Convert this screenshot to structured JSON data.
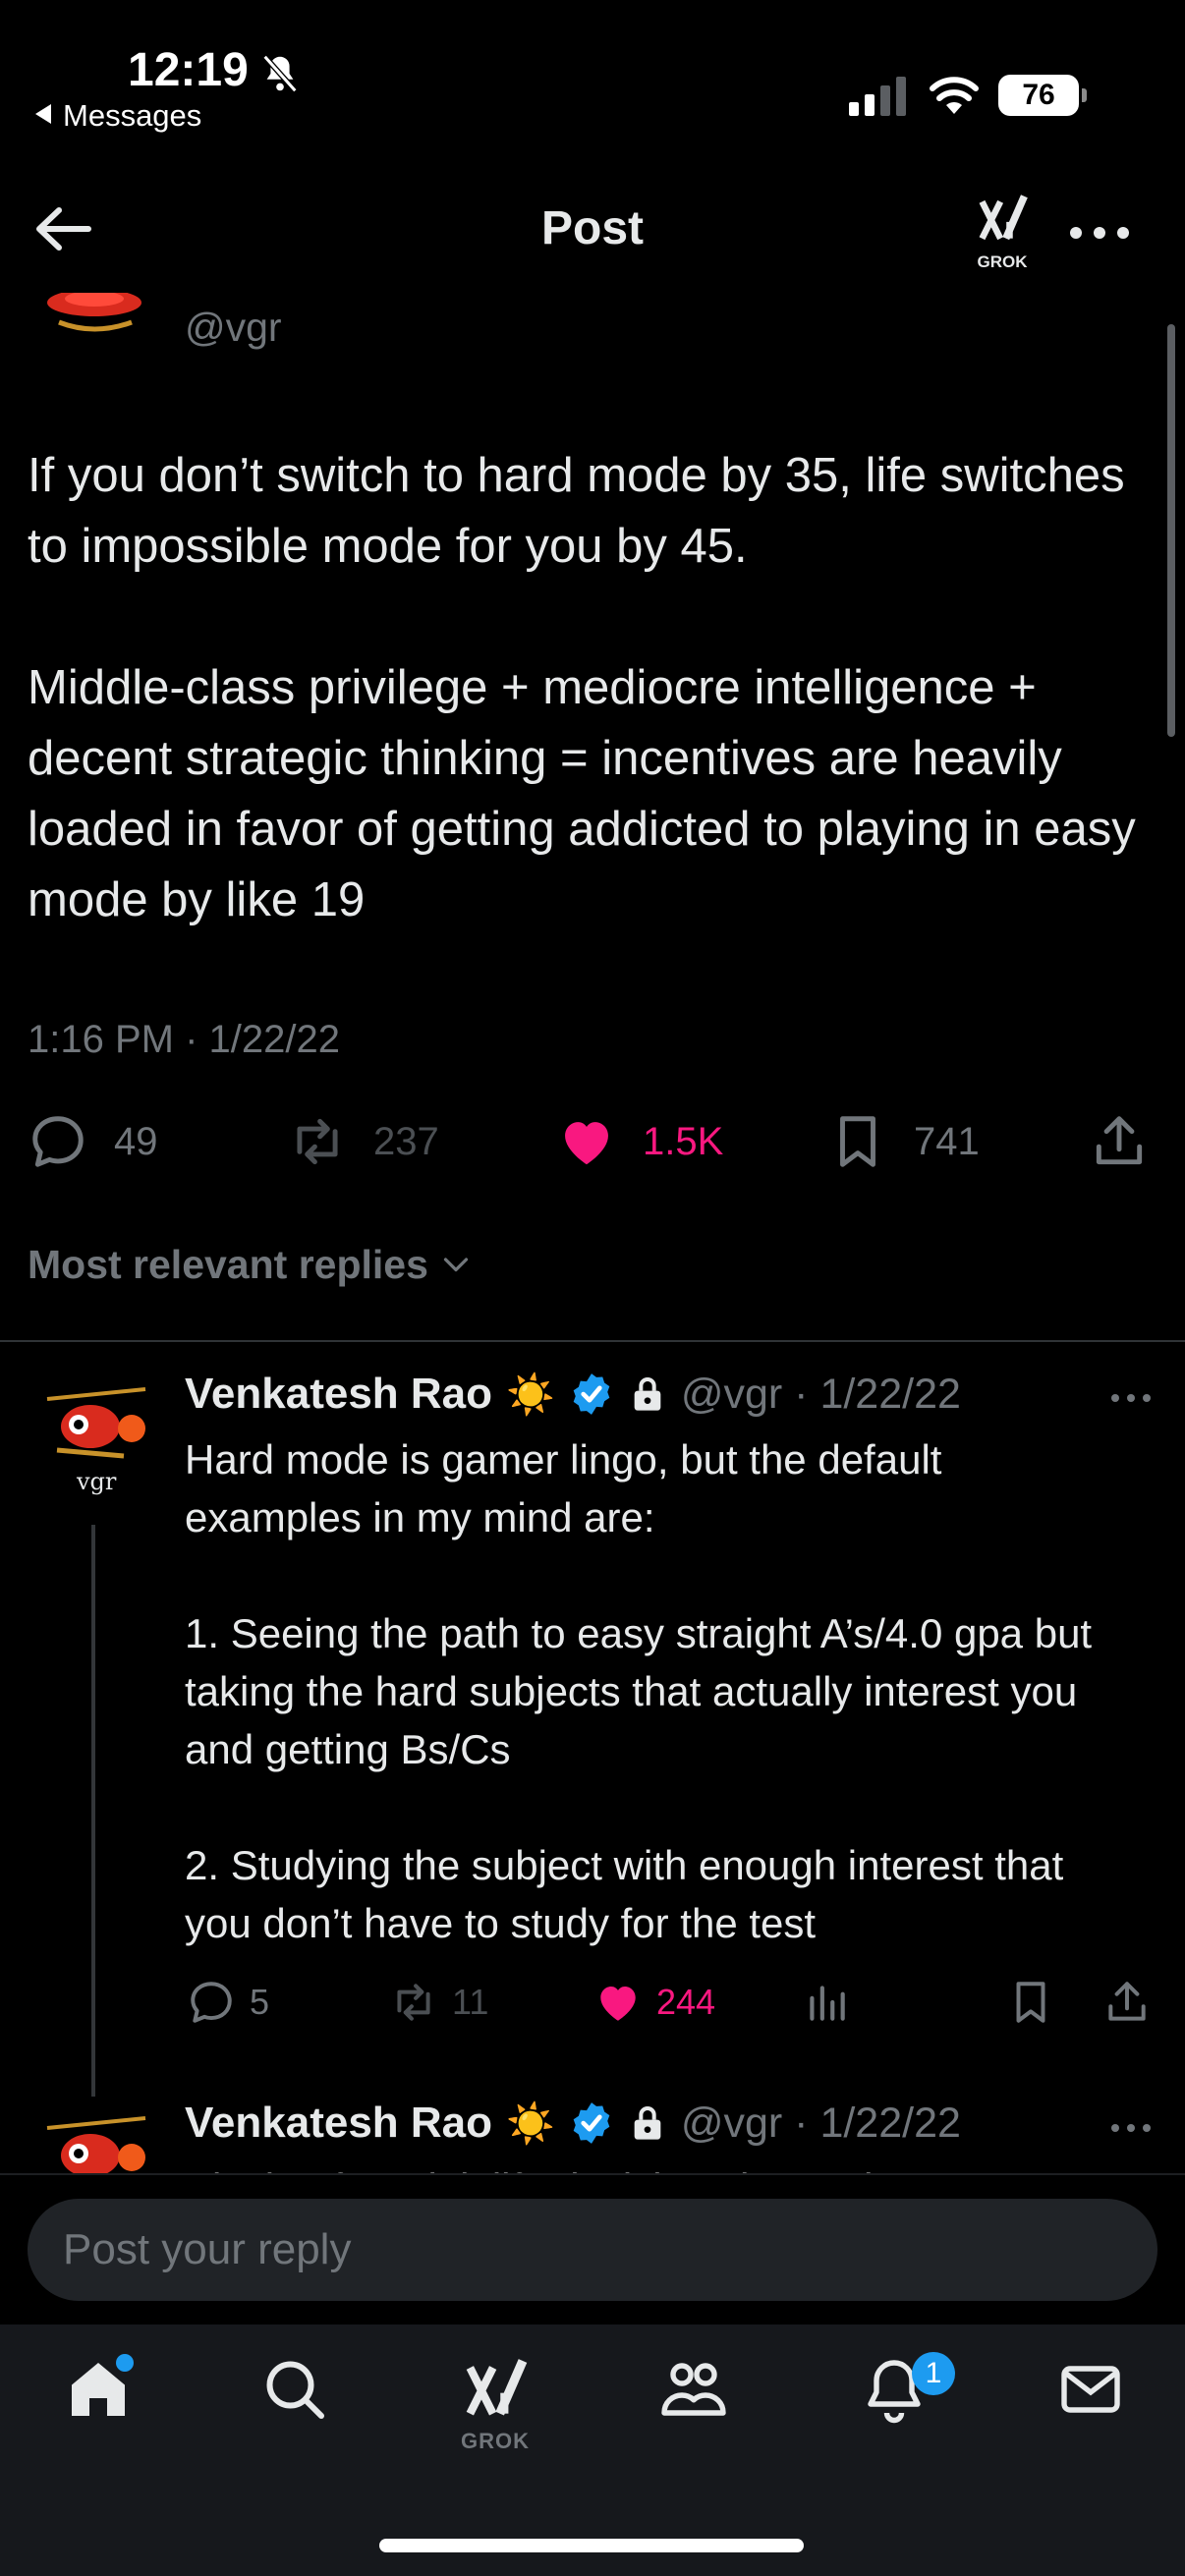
{
  "status_bar": {
    "time": "12:19",
    "back_app": "Messages",
    "battery": "76",
    "icons": [
      "bell-slash-icon",
      "cellular-signal-icon",
      "wifi-icon",
      "battery-icon"
    ]
  },
  "header": {
    "title": "Post",
    "grok_label": "GROK",
    "icons": [
      "back-arrow-icon",
      "grok-icon",
      "more-icon"
    ]
  },
  "post": {
    "handle": "@vgr",
    "paragraphs": [
      "If you don’t switch to hard mode by 35, life switches to impossible mode for you by 45.",
      "Middle-class privilege + mediocre intelligence + decent strategic thinking = incentives are heavily loaded in favor of getting addicted to playing in easy mode by like 19"
    ],
    "timestamp": "1:16 PM · 1/22/22",
    "replies": "49",
    "reposts": "237",
    "likes": "1.5K",
    "bookmarks": "741"
  },
  "sort": {
    "label": "Most relevant replies"
  },
  "replies": [
    {
      "name": "Venkatesh Rao",
      "emoji": "☀️",
      "meta": "@vgr · 1/22/22",
      "avatar_text": "vgr",
      "paragraphs": [
        "Hard mode is gamer lingo, but the default examples in my mind are:",
        "1. Seeing the path to easy straight A’s/4.0 gpa but taking the hard subjects that actually interest you and getting Bs/Cs",
        "2. Studying the subject with enough interest that you don’t have to study for the test"
      ],
      "replies": "5",
      "reposts": "11",
      "likes": "244"
    },
    {
      "name": "Venkatesh Rao",
      "emoji": "☀️",
      "meta": "@vgr · 1/22/22",
      "text_cut": "Playing for adult life decisions has a th..."
    }
  ],
  "composer": {
    "placeholder": "Post your reply"
  },
  "tabbar": {
    "grok_label": "GROK",
    "notification_count": "1",
    "tabs": [
      "home-icon",
      "search-icon",
      "grok-icon",
      "communities-icon",
      "notifications-icon",
      "messages-icon"
    ]
  },
  "colors": {
    "background": "#000000",
    "text": "#e7e9ea",
    "muted": "#71767b",
    "like": "#f91880",
    "accent": "#1d9bf0"
  }
}
